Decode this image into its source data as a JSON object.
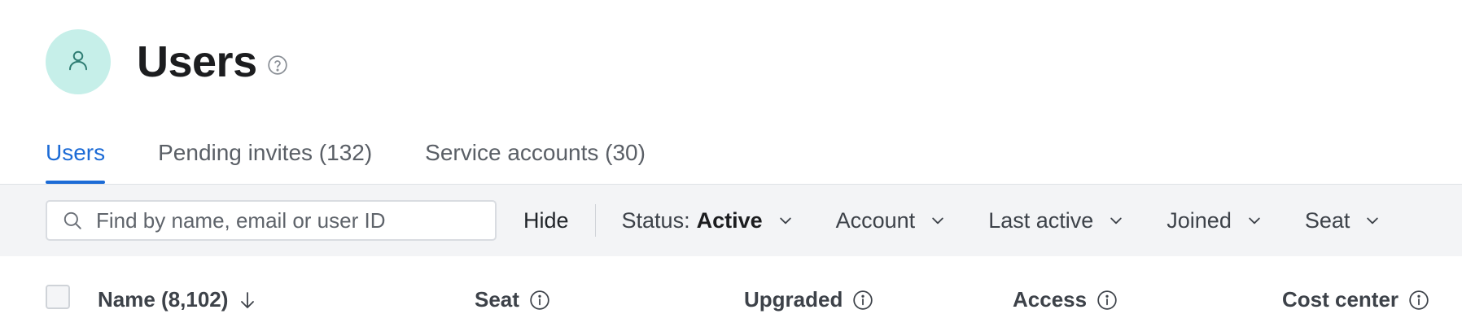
{
  "header": {
    "title": "Users",
    "avatar_icon": "user-icon",
    "help_icon": "help-circle-icon"
  },
  "tabs": [
    {
      "label": "Users",
      "active": true
    },
    {
      "label": "Pending invites (132)",
      "active": false
    },
    {
      "label": "Service accounts (30)",
      "active": false
    }
  ],
  "filters": {
    "search_placeholder": "Find by name, email or user ID",
    "search_value": "",
    "hide_label": "Hide",
    "status_label": "Status:",
    "status_value": "Active",
    "account_label": "Account",
    "last_active_label": "Last active",
    "joined_label": "Joined",
    "seat_label": "Seat"
  },
  "table": {
    "columns": [
      {
        "label": "Name (8,102)",
        "icon": "arrow-down-icon"
      },
      {
        "label": "Seat",
        "icon": "info-icon"
      },
      {
        "label": "Upgraded",
        "icon": "info-icon"
      },
      {
        "label": "Access",
        "icon": "info-icon"
      },
      {
        "label": "Cost center",
        "icon": "info-icon"
      }
    ]
  },
  "colors": {
    "accent": "#1c6bd6",
    "avatar_bg": "#c6efe9",
    "filter_bg": "#f3f4f6",
    "avatar_icon": "#2f7d73"
  }
}
